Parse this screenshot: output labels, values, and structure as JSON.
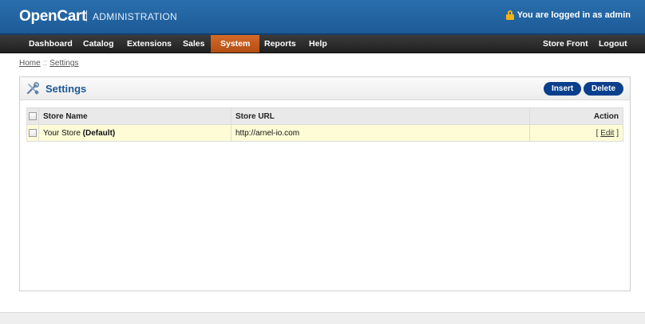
{
  "header": {
    "logo": "OpenCart",
    "admin_label": "ADMINISTRATION",
    "login_text": "You are logged in as admin"
  },
  "menu": {
    "items": [
      "Dashboard",
      "Catalog",
      "Extensions",
      "Sales",
      "System",
      "Reports",
      "Help"
    ],
    "active": "System",
    "right_items": [
      "Store Front",
      "Logout"
    ]
  },
  "breadcrumb": {
    "items": [
      "Home",
      "Settings"
    ],
    "separator": "::"
  },
  "panel": {
    "title": "Settings",
    "insert_label": "Insert",
    "delete_label": "Delete"
  },
  "table": {
    "columns": [
      "Store Name",
      "Store URL",
      "Action"
    ],
    "rows": [
      {
        "store_name": "Your Store",
        "store_default": "(Default)",
        "store_url": "http://arnel-io.com",
        "action_open": "[",
        "action_label": "Edit",
        "action_close": "]"
      }
    ]
  },
  "colors": {
    "header_blue": "#1c5a96",
    "menu_active": "#c95a1c",
    "button_blue": "#0a3f8c",
    "row_highlight": "#fdfcd6",
    "title_blue": "#1d5a94"
  },
  "icons": {
    "lock": "lock-icon",
    "settings": "wrench-screwdriver-icon"
  }
}
